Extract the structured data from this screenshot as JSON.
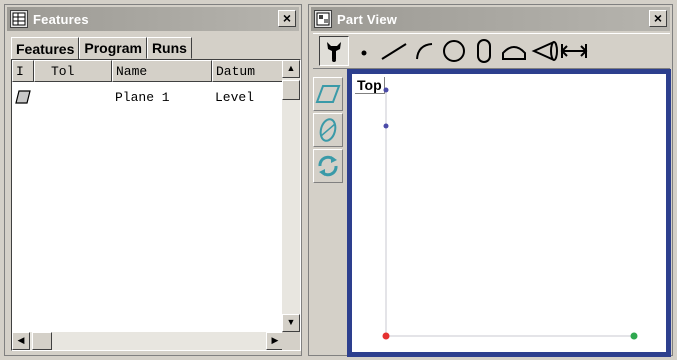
{
  "features_window": {
    "title": "Features",
    "close_glyph": "×",
    "tabs": [
      {
        "label": "Features",
        "active": true
      },
      {
        "label": "Program",
        "active": false
      },
      {
        "label": "Runs",
        "active": false
      }
    ],
    "columns": [
      "I",
      "Tol",
      "Name",
      "Datum"
    ],
    "rows": [
      {
        "icon": "plane-feature-icon",
        "tol": "",
        "name": "Plane 1",
        "datum": "Level"
      }
    ]
  },
  "part_view_window": {
    "title": "Part View",
    "close_glyph": "×",
    "toolbar": [
      {
        "name": "probe-tool",
        "icon": "probe-icon"
      },
      {
        "name": "point-tool",
        "icon": "point-icon"
      },
      {
        "name": "line-tool",
        "icon": "line-icon"
      },
      {
        "name": "arc-tool",
        "icon": "arc-icon"
      },
      {
        "name": "circle-tool",
        "icon": "circle-icon"
      },
      {
        "name": "slot-tool",
        "icon": "slot-icon"
      },
      {
        "name": "plane-tool",
        "icon": "plane-icon"
      },
      {
        "name": "cone-tool",
        "icon": "cone-icon"
      },
      {
        "name": "distance-tool",
        "icon": "distance-icon"
      }
    ],
    "side_tools": [
      {
        "name": "view-plane-tool",
        "icon": "plane-view-icon"
      },
      {
        "name": "view-tilt-tool",
        "icon": "tilt-view-icon"
      },
      {
        "name": "view-rotate-tool",
        "icon": "rotate-view-icon"
      }
    ],
    "view": {
      "label": "Top",
      "border_color": "#2d3f8e",
      "origin_color": "#e53030",
      "endpoint_color": "#2fa84f",
      "axis_marker_color": "#4a4aa8"
    }
  }
}
